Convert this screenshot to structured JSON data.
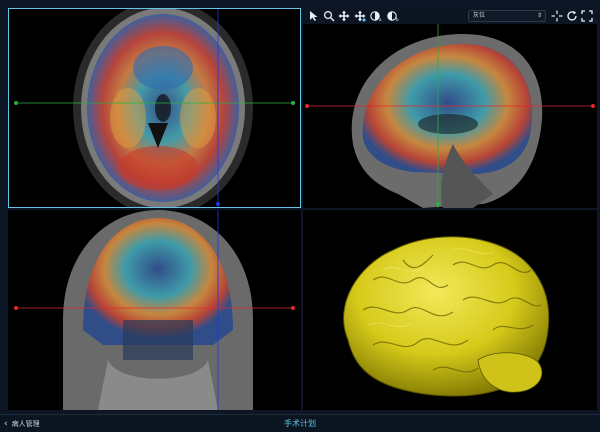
{
  "toolbar": {
    "tools": [
      {
        "name": "pointer-icon"
      },
      {
        "name": "zoom-icon"
      },
      {
        "name": "pan-icon"
      },
      {
        "name": "move-crosshair-icon"
      },
      {
        "name": "contrast-a-icon"
      },
      {
        "name": "contrast-b-icon"
      }
    ],
    "series_select": {
      "value": "灰位"
    },
    "right_tools": [
      {
        "name": "crosshair-icon"
      },
      {
        "name": "rotate-icon"
      },
      {
        "name": "fullscreen-icon"
      }
    ]
  },
  "statusbar": {
    "back_label": "病人管理",
    "title": "手术计划"
  },
  "colors": {
    "accent": "#5ec3e4",
    "crosshair_red": "#e0282a",
    "crosshair_green": "#28b040",
    "crosshair_blue": "#2036e6",
    "brain_3d": "#d8cc1a"
  }
}
